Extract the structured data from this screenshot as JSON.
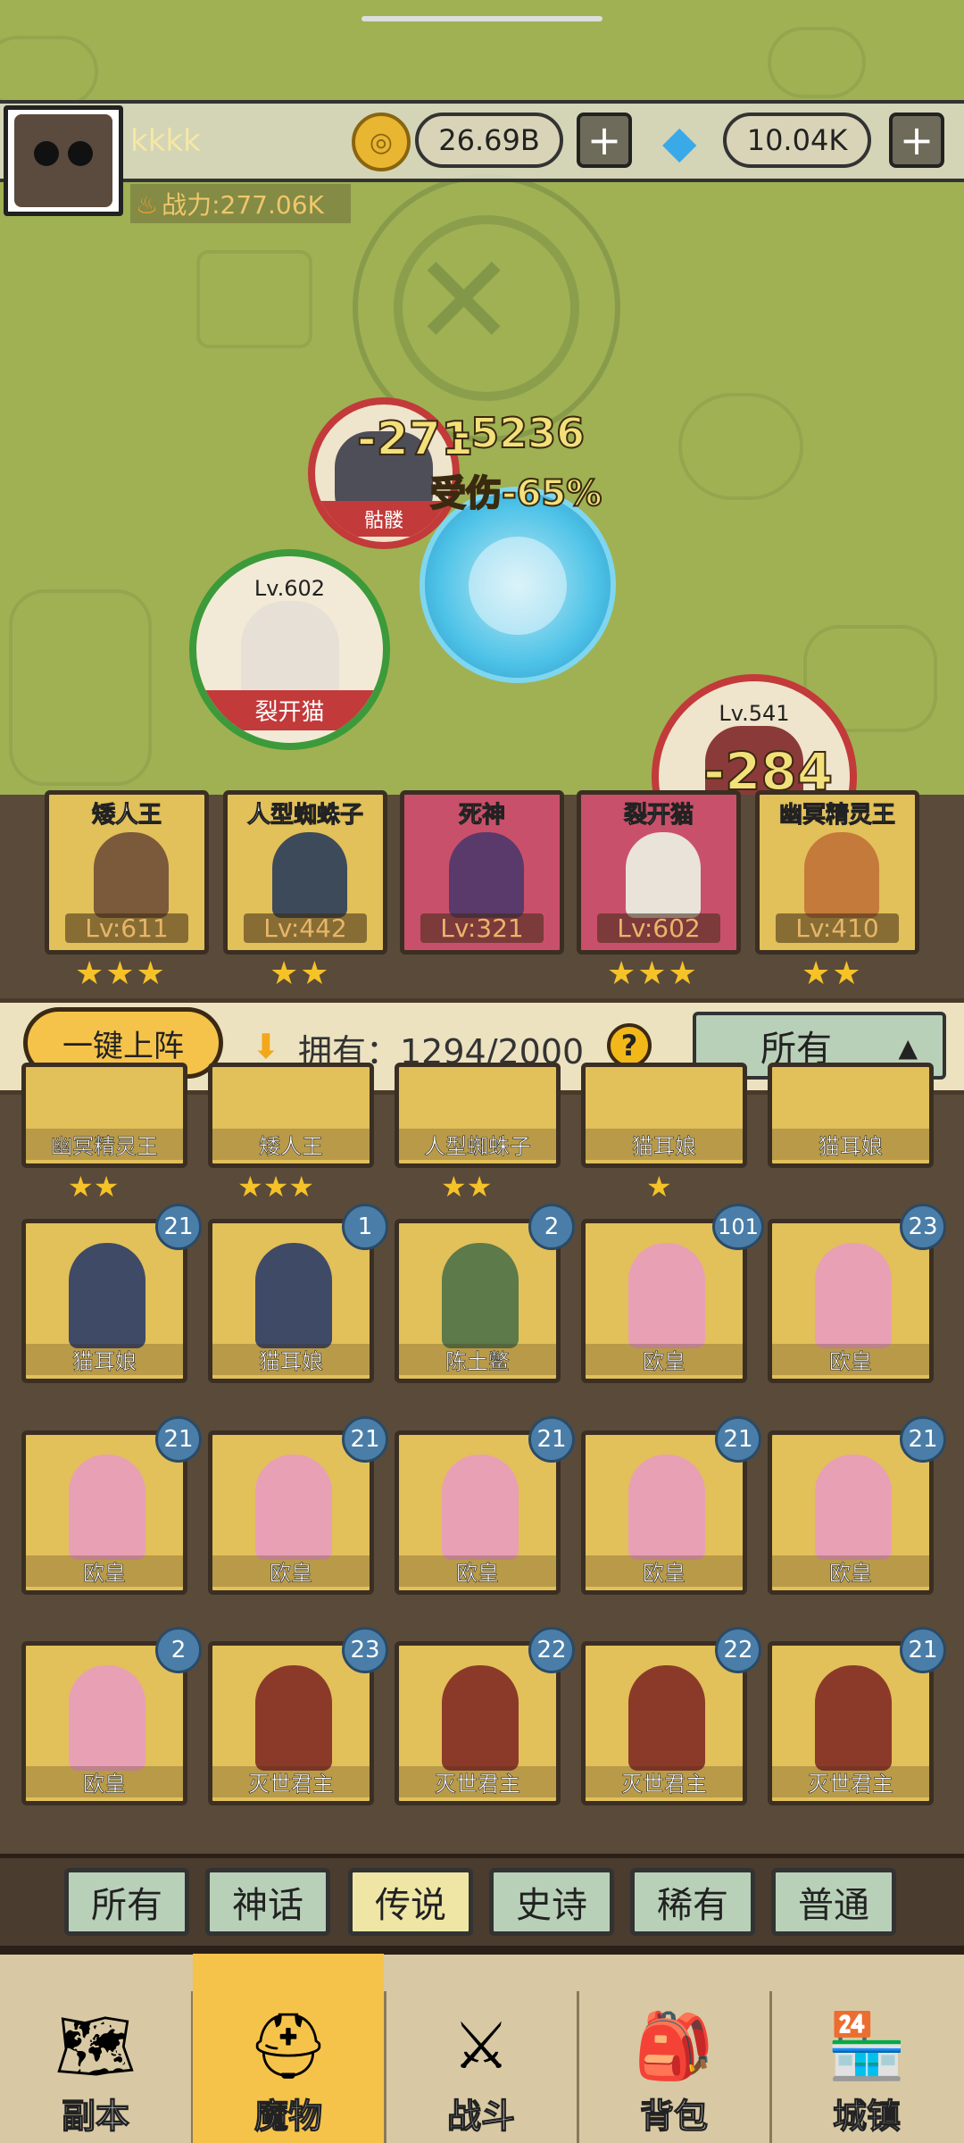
{
  "header": {
    "username": "kkkk",
    "power_label": "战力:277.06K",
    "gold": "26.69B",
    "diamonds": "10.04K",
    "plus_symbol": "+"
  },
  "battle": {
    "units": [
      {
        "level": "Lv.602",
        "name": "裂开猫"
      },
      {
        "level": "Lv.541",
        "name": ""
      },
      {
        "level": "",
        "name": "骷髅"
      }
    ],
    "floating_texts": [
      "-271",
      "-5236",
      "受伤-65%",
      "-284"
    ]
  },
  "team": [
    {
      "name": "矮人王",
      "level": "Lv:611",
      "stars": "★★★"
    },
    {
      "name": "人型蜘蛛子",
      "level": "Lv:442",
      "stars": "★★"
    },
    {
      "name": "死神",
      "level": "Lv:321",
      "stars": ""
    },
    {
      "name": "裂开猫",
      "level": "Lv:602",
      "stars": "★★★"
    },
    {
      "name": "幽冥精灵王",
      "level": "Lv:410",
      "stars": "★★"
    }
  ],
  "filter": {
    "deploy_label": "一键上阵",
    "own_label": "拥有：1294/2000",
    "help": "?",
    "sort_selected": "所有",
    "caret": "▲"
  },
  "grid": {
    "row0": [
      {
        "name": "幽冥精灵王",
        "stars": "★★"
      },
      {
        "name": "矮人王",
        "stars": "★★★"
      },
      {
        "name": "人型蜘蛛子",
        "stars": "★★"
      },
      {
        "name": "猫耳娘",
        "stars": "★"
      },
      {
        "name": "猫耳娘",
        "stars": ""
      }
    ],
    "row1": [
      {
        "name": "猫耳娘",
        "count": "21"
      },
      {
        "name": "猫耳娘",
        "count": "1"
      },
      {
        "name": "陈土鳖",
        "count": "2"
      },
      {
        "name": "欧皇",
        "count": "101"
      },
      {
        "name": "欧皇",
        "count": "23"
      }
    ],
    "row2": [
      {
        "name": "欧皇",
        "count": "21"
      },
      {
        "name": "欧皇",
        "count": "21"
      },
      {
        "name": "欧皇",
        "count": "21"
      },
      {
        "name": "欧皇",
        "count": "21"
      },
      {
        "name": "欧皇",
        "count": "21"
      }
    ],
    "row3": [
      {
        "name": "欧皇",
        "count": "2"
      },
      {
        "name": "灭世君主",
        "count": "23"
      },
      {
        "name": "灭世君主",
        "count": "22"
      },
      {
        "name": "灭世君主",
        "count": "22"
      },
      {
        "name": "灭世君主",
        "count": "21"
      }
    ]
  },
  "rarity_tabs": [
    "所有",
    "神话",
    "传说",
    "史诗",
    "稀有",
    "普通"
  ],
  "rarity_active": "传说",
  "nav": [
    {
      "label": "副本",
      "icon": "map-icon"
    },
    {
      "label": "魔物",
      "icon": "helmet-icon"
    },
    {
      "label": "战斗",
      "icon": "crossed-swords-icon"
    },
    {
      "label": "背包",
      "icon": "backpack-icon"
    },
    {
      "label": "城镇",
      "icon": "shop-icon"
    }
  ],
  "nav_active": "魔物",
  "colors": {
    "field": "#9fb153",
    "panel": "#5a4a3a",
    "card_gold": "#e2c05a",
    "card_red": "#c9506a",
    "badge_blue": "#4a7ea8",
    "accent_yellow": "#f6c34a",
    "tab_green": "#b9d0b8"
  }
}
